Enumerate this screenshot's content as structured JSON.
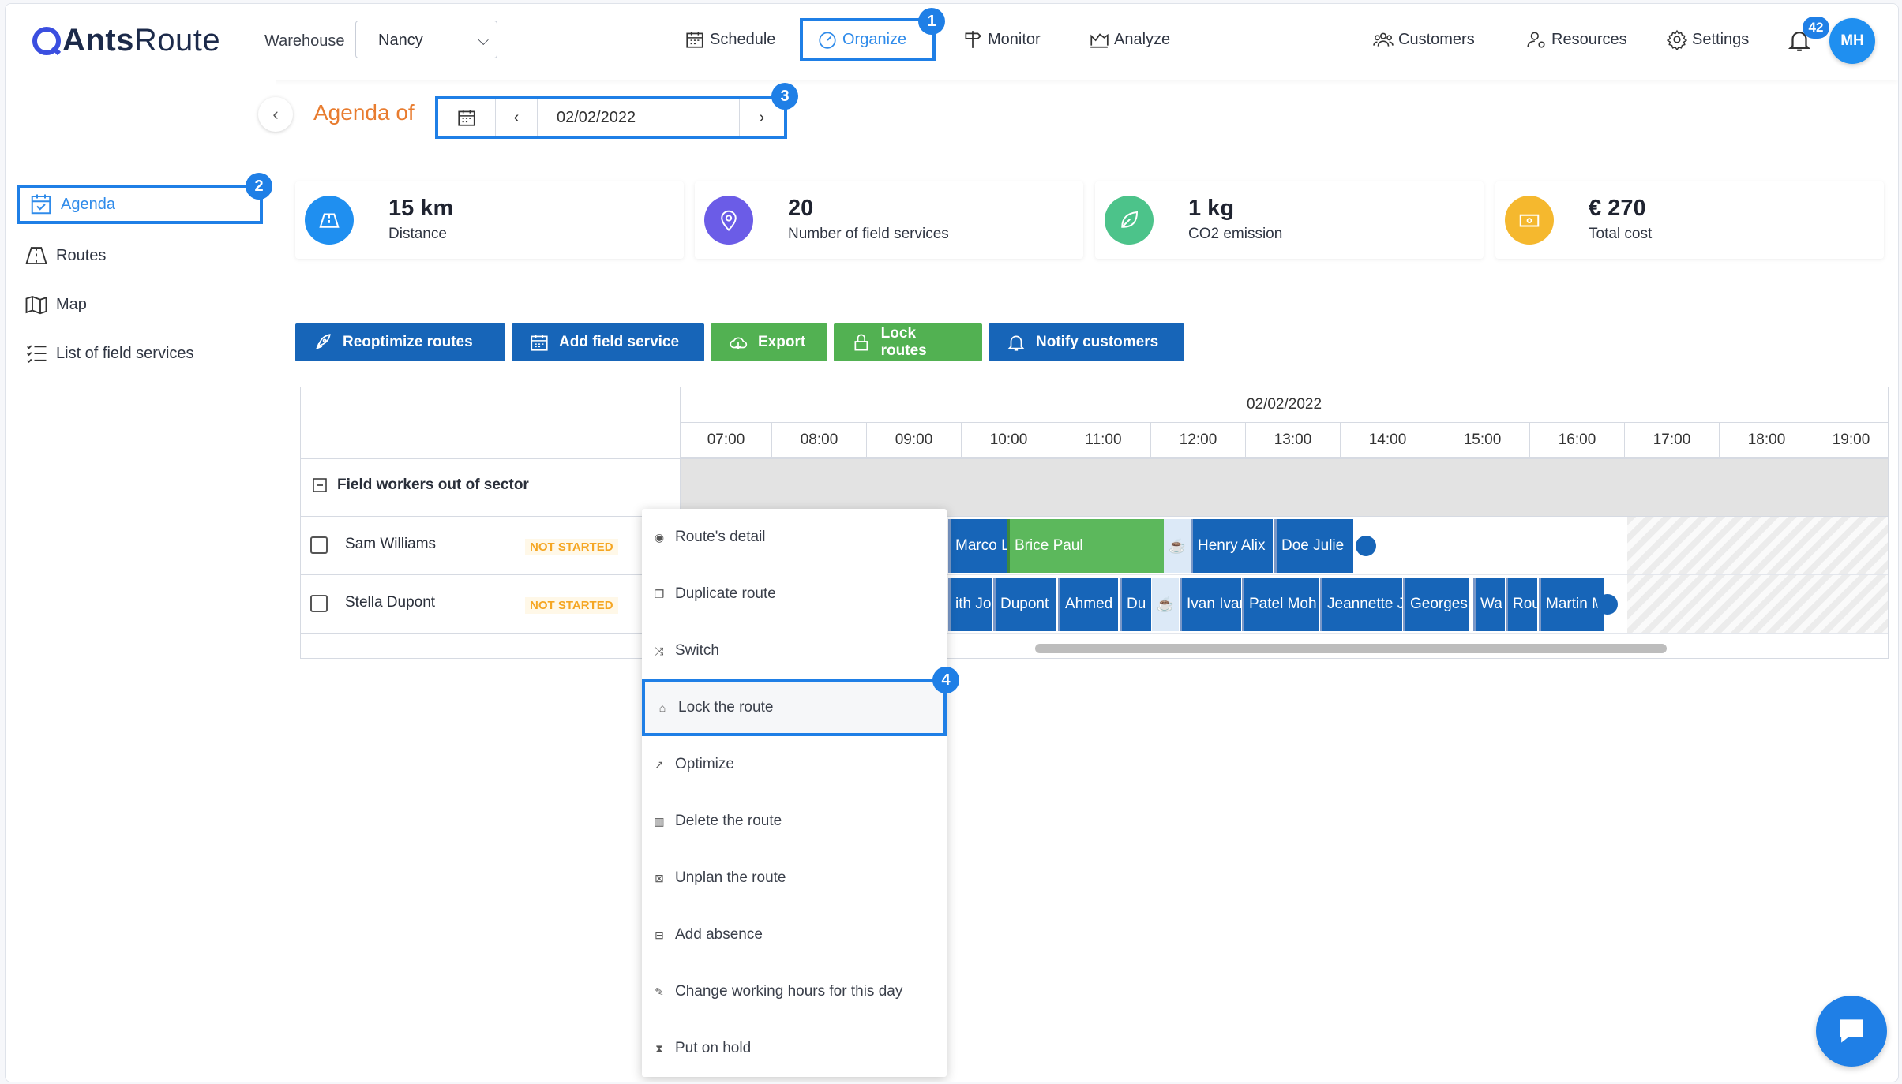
{
  "app": {
    "name_bold": "Ants",
    "name_light": "Route"
  },
  "header": {
    "warehouse_label": "Warehouse",
    "warehouse_value": "Nancy",
    "nav": [
      {
        "label": "Schedule",
        "icon": "calendar-icon"
      },
      {
        "label": "Organize",
        "icon": "gauge-icon"
      },
      {
        "label": "Monitor",
        "icon": "signpost-icon"
      },
      {
        "label": "Analyze",
        "icon": "chart-icon"
      },
      {
        "label": "Customers",
        "icon": "users-icon"
      },
      {
        "label": "Resources",
        "icon": "user-gear-icon"
      },
      {
        "label": "Settings",
        "icon": "gear-icon"
      }
    ],
    "notification_count": "42",
    "avatar_initials": "MH"
  },
  "callouts": [
    "1",
    "2",
    "3",
    "4"
  ],
  "sidebar": {
    "items": [
      {
        "label": "Agenda",
        "icon": "calendar-check-icon"
      },
      {
        "label": "Routes",
        "icon": "route-icon"
      },
      {
        "label": "Map",
        "icon": "map-icon"
      },
      {
        "label": "List of field services",
        "icon": "list-icon"
      }
    ]
  },
  "agenda": {
    "title": "Agenda of",
    "date": "02/02/2022"
  },
  "stats": [
    {
      "value": "15 km",
      "label": "Distance",
      "color": "#1f8ff0",
      "icon": "road-icon"
    },
    {
      "value": "20",
      "label": "Number of field services",
      "color": "#6b5ce7",
      "icon": "pin-icon"
    },
    {
      "value": "1 kg",
      "label": "CO2 emission",
      "color": "#4cc38a",
      "icon": "leaf-icon"
    },
    {
      "value": "€ 270",
      "label": "Total cost",
      "color": "#f5b82e",
      "icon": "money-icon"
    }
  ],
  "actions": [
    {
      "label": "Reoptimize routes",
      "color": "#1765b8",
      "icon": "rocket-icon"
    },
    {
      "label": "Add field service",
      "color": "#1765b8",
      "icon": "calendar-plus-icon"
    },
    {
      "label": "Export",
      "color": "#52b152",
      "icon": "cloud-icon"
    },
    {
      "label": "Lock routes",
      "color": "#52b152",
      "icon": "lock-icon"
    },
    {
      "label": "Notify customers",
      "color": "#1765b8",
      "icon": "bell-icon"
    }
  ],
  "gantt": {
    "date": "02/02/2022",
    "hours": [
      "07:00",
      "08:00",
      "09:00",
      "10:00",
      "11:00",
      "12:00",
      "13:00",
      "14:00",
      "15:00",
      "16:00",
      "17:00",
      "18:00",
      "19:00"
    ],
    "sector_label": "Field workers out of sector",
    "workers": [
      {
        "name": "Sam Williams",
        "status": "NOT STARTED",
        "segments": [
          "Marco L",
          "Brice Paul",
          "Henry Alix",
          "Doe Julie"
        ]
      },
      {
        "name": "Stella Dupont",
        "status": "NOT STARTED",
        "segments": [
          "ith Jo",
          "Dupont",
          "Ahmed",
          "Du",
          "Ivan Ivan",
          "Patel Moh",
          "Jeannette J",
          "Georges",
          "Wa",
          "Rou",
          "Martin M"
        ]
      }
    ]
  },
  "context_menu": {
    "items": [
      {
        "label": "Route's detail",
        "icon": "eye-icon"
      },
      {
        "label": "Duplicate route",
        "icon": "copy-icon"
      },
      {
        "label": "Switch",
        "icon": "shuffle-icon"
      },
      {
        "label": "Lock the route",
        "icon": "lock-icon"
      },
      {
        "label": "Optimize",
        "icon": "rocket-icon"
      },
      {
        "label": "Delete the route",
        "icon": "trash-icon"
      },
      {
        "label": "Unplan the route",
        "icon": "calendar-x-icon"
      },
      {
        "label": "Add absence",
        "icon": "calendar-minus-icon"
      },
      {
        "label": "Change working hours for this day",
        "icon": "pencil-icon"
      },
      {
        "label": "Put on hold",
        "icon": "hourglass-icon"
      }
    ]
  }
}
